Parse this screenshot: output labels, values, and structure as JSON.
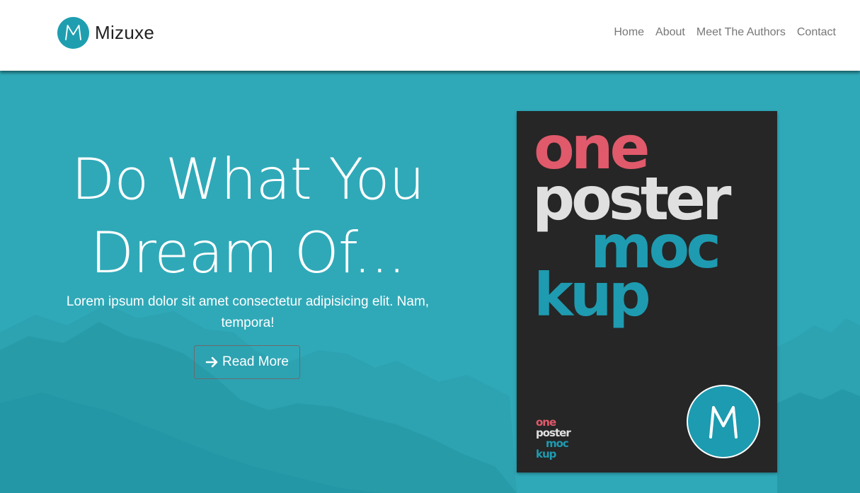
{
  "brand": {
    "name": "Mizuxe",
    "logo_letter": "M",
    "logo_icon": "m-logo-icon",
    "color": "#1f9eb0"
  },
  "nav": {
    "items": [
      "Home",
      "About",
      "Meet The Authors",
      "Contact"
    ]
  },
  "hero": {
    "headline_line1": "Do What You",
    "headline_line2": "Dream Of...",
    "subtext": "Lorem ipsum dolor sit amet consectetur adipisicing elit. Nam, tempora!",
    "button_icon": "arrow-right-icon",
    "button_label": "Read More",
    "background_color": "#2fa9b8"
  },
  "poster": {
    "words": [
      "one",
      "poster",
      "moc",
      "kup"
    ],
    "mini_words": [
      "one",
      "poster",
      "moc",
      "kup"
    ],
    "badge_letter": "M",
    "colors": {
      "pink": "#e05a6b",
      "light": "#e0e0e0",
      "teal": "#1e9bb0",
      "background": "#262626"
    }
  }
}
